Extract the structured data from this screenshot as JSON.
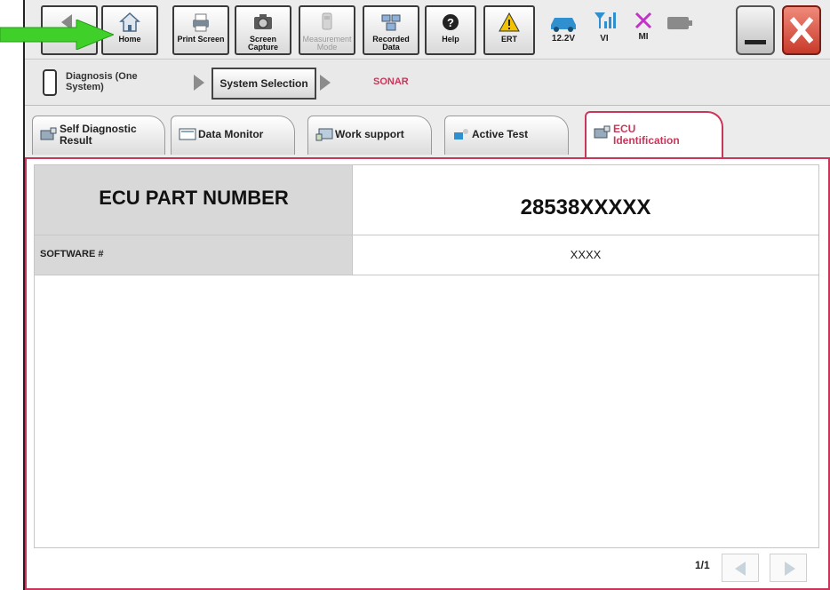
{
  "toolbar": {
    "home_label": "Home",
    "print_screen_label": "Print Screen",
    "screen_capture_label": "Screen Capture",
    "measurement_mode_label": "Measurement Mode",
    "recorded_data_label": "Recorded Data",
    "help_label": "Help",
    "ert_label": "ERT",
    "battery_voltage": "12.2V",
    "vi_label": "VI",
    "mi_label": "MI"
  },
  "breadcrumb": {
    "step1": "Diagnosis (One System)",
    "step2": "System Selection",
    "step3": "SONAR"
  },
  "tabs": [
    {
      "label": "Self Diagnostic Result"
    },
    {
      "label": "Data Monitor"
    },
    {
      "label": "Work support"
    },
    {
      "label": "Active Test"
    },
    {
      "label": "ECU Identification"
    }
  ],
  "table": {
    "part_number_label": "ECU PART NUMBER",
    "part_number_value": "28538XXXXX",
    "software_label": "SOFTWARE #",
    "software_value": "XXXX"
  },
  "pagination": {
    "page": "1/1"
  },
  "colors": {
    "accent": "#c8375a",
    "pointer": "#3fd12a"
  }
}
